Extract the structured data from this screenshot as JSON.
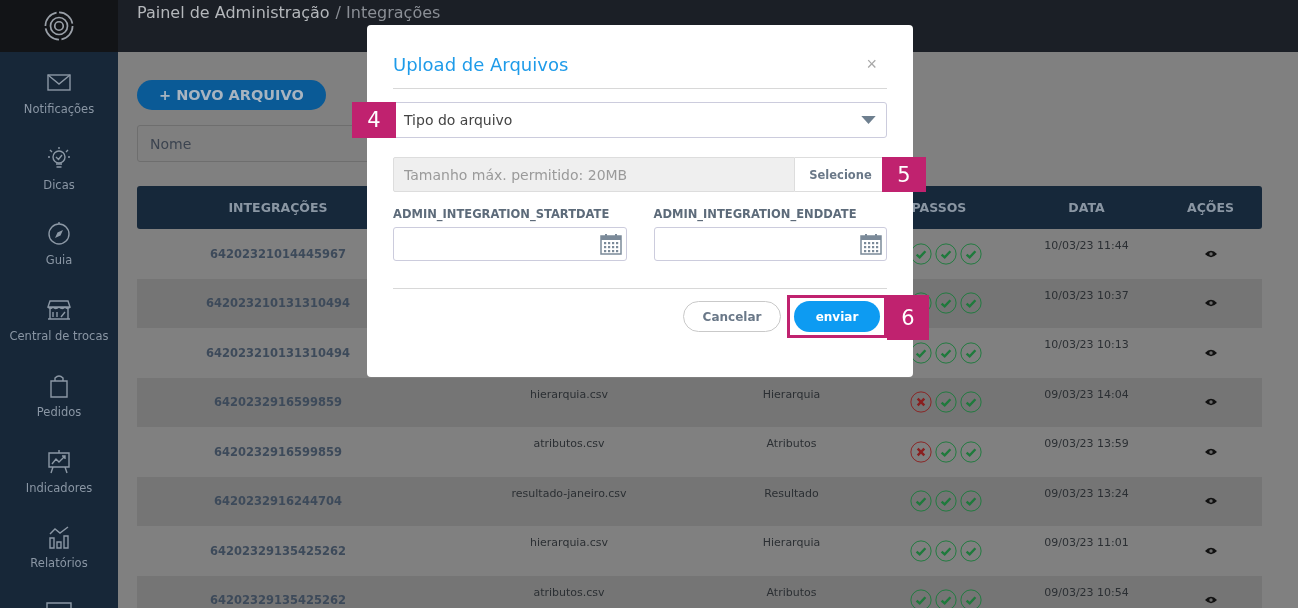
{
  "header": {
    "title": "Painel de Administração",
    "subtitle": "/ Integrações"
  },
  "sidebar": {
    "items": [
      {
        "label": "Notificações"
      },
      {
        "label": "Dicas"
      },
      {
        "label": "Guia"
      },
      {
        "label": "Central de trocas"
      },
      {
        "label": "Pedidos"
      },
      {
        "label": "Indicadores"
      },
      {
        "label": "Relatórios"
      },
      {
        "kind": "cut"
      }
    ]
  },
  "toolbar": {
    "new_button": "+ NOVO ARQUIVO",
    "search_placeholder": "Nome"
  },
  "table": {
    "columns": [
      "INTEGRAÇÕES",
      "PASSOS",
      "DATA",
      "AÇÕES"
    ],
    "rows": [
      {
        "id": "64202321014445967",
        "steps": [
          true,
          true,
          true
        ],
        "date": "10/03/23 11:44"
      },
      {
        "id": "642023210131310494",
        "steps": [
          true,
          true,
          true
        ],
        "date": "10/03/23 10:37"
      },
      {
        "id": "642023210131310494",
        "steps": [
          true,
          true,
          true
        ],
        "date": "10/03/23 10:13"
      },
      {
        "id": "6420232916599859",
        "file": "hierarquia.csv",
        "type": "Hierarquia",
        "steps": [
          false,
          true,
          true
        ],
        "date": "09/03/23 14:04"
      },
      {
        "id": "6420232916599859",
        "file": "atributos.csv",
        "type": "Atributos",
        "steps": [
          false,
          true,
          true
        ],
        "date": "09/03/23 13:59"
      },
      {
        "id": "6420232916244704",
        "file": "resultado-janeiro.csv",
        "type": "Resultado",
        "steps": [
          true,
          true,
          true
        ],
        "date": "09/03/23 13:24"
      },
      {
        "id": "64202329135425262",
        "file": "hierarquia.csv",
        "type": "Hierarquia",
        "steps": [
          true,
          true,
          true
        ],
        "date": "09/03/23 11:01"
      },
      {
        "id": "64202329135425262",
        "file": "atributos.csv",
        "type": "Atributos",
        "steps": [
          true,
          true,
          true
        ],
        "date": "09/03/23 10:54"
      }
    ]
  },
  "modal": {
    "title": "Upload de Arquivos",
    "close": "×",
    "select": {
      "value": "Tipo do arquivo",
      "marker": "4"
    },
    "file": {
      "placeholder": "Tamanho máx. permitido: 20MB",
      "button": "Selecione",
      "marker": "5"
    },
    "dates": [
      {
        "label": "ADMIN_INTEGRATION_STARTDATE"
      },
      {
        "label": "ADMIN_INTEGRATION_ENDDATE"
      }
    ],
    "cancel": "Cancelar",
    "submit": {
      "label": "enviar",
      "marker": "6",
      "highlighted": true
    }
  }
}
